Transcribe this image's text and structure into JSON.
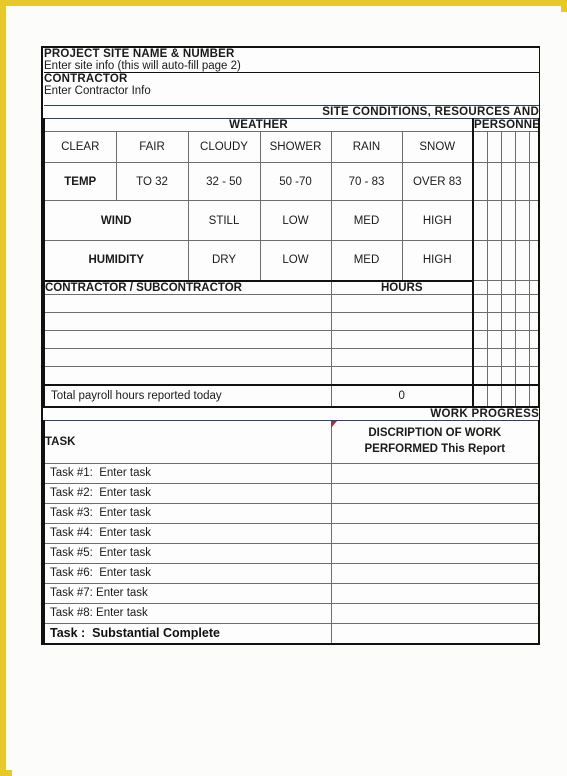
{
  "document": {
    "type": "construction-daily-report-form",
    "accent_blue": "#95b3d7",
    "header_gray": "#ebebeb",
    "page_border": "#e8c92a"
  },
  "header": {
    "project_label": "PROJECT SITE NAME & NUMBER",
    "project_value": "Enter site info (this will auto-fill page 2)",
    "contractor_label": "CONTRACTOR",
    "contractor_value": "Enter Contractor Info"
  },
  "banner": {
    "site_conditions": "SITE CONDITIONS, RESOURCES AND",
    "work_progress": "WORK PROGRESS"
  },
  "weather": {
    "section_label": "WEATHER",
    "personnel_label": "PERSONNEL",
    "conditions": [
      "CLEAR",
      "FAIR",
      "CLOUDY",
      "SHOWER",
      "RAIN",
      "SNOW"
    ],
    "rows": [
      {
        "label": "TEMP",
        "values": [
          "TO 32",
          "32 - 50",
          "50 -70",
          "70 - 83",
          "OVER 83"
        ]
      },
      {
        "label": "WIND",
        "values": [
          "STILL",
          "LOW",
          "MED",
          "HIGH"
        ]
      },
      {
        "label": "HUMIDITY",
        "values": [
          "DRY",
          "LOW",
          "MED",
          "HIGH"
        ]
      }
    ]
  },
  "contractor_section": {
    "name_header": "CONTRACTOR / SUBCONTRACTOR",
    "hours_header": "HOURS",
    "blank_row_count": 5,
    "total_label": "Total payroll hours reported today",
    "total_value": "0"
  },
  "work_progress": {
    "task_header": "TASK",
    "description_header_line1": "DISCRIPTION OF WORK",
    "description_header_line2": "PERFORMED  This Report",
    "tasks": [
      "Task #1:  Enter task",
      "Task #2:  Enter task",
      "Task #3:  Enter task",
      "Task #4:  Enter task",
      "Task #5:  Enter task",
      "Task #6:  Enter task",
      "Task #7: Enter task",
      "Task #8: Enter task"
    ],
    "final_task": "Task :  Substantial Complete"
  }
}
